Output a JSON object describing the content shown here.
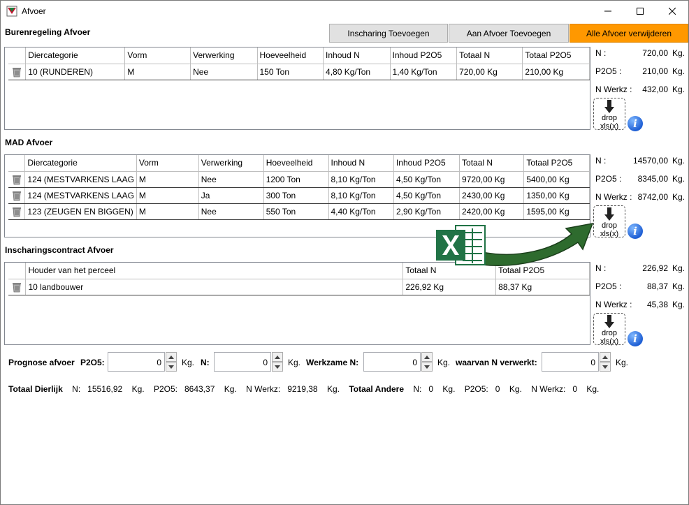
{
  "window": {
    "title": "Afvoer"
  },
  "buttons": {
    "inscharing": "Inscharing Toevoegen",
    "aan_afvoer": "Aan Afvoer Toevoegen",
    "alle_verwijderen": "Alle Afvoer verwijderen"
  },
  "burenregeling": {
    "title": "Burenregeling Afvoer",
    "columns": [
      "Diercategorie",
      "Vorm",
      "Verwerking",
      "Hoeveelheid",
      "Inhoud N",
      "Inhoud P2O5",
      "Totaal N",
      "Totaal P2O5"
    ],
    "rows": [
      [
        "10 (RUNDEREN)",
        "M",
        "Nee",
        "150 Ton",
        "4,80 Kg/Ton",
        "1,40 Kg/Ton",
        "720,00 Kg",
        "210,00 Kg"
      ]
    ],
    "summary": {
      "n_label": "N :",
      "n": "720,00",
      "p_label": "P2O5 :",
      "p": "210,00",
      "w_label": "N Werkz :",
      "w": "432,00",
      "unit": "Kg."
    }
  },
  "mad": {
    "title": "MAD Afvoer",
    "columns": [
      "Diercategorie",
      "Vorm",
      "Verwerking",
      "Hoeveelheid",
      "Inhoud N",
      "Inhoud P2O5",
      "Totaal N",
      "Totaal P2O5"
    ],
    "rows": [
      [
        "124 (MESTVARKENS LAAG",
        "M",
        "Nee",
        "1200 Ton",
        "8,10 Kg/Ton",
        "4,50 Kg/Ton",
        "9720,00 Kg",
        "5400,00 Kg"
      ],
      [
        "124 (MESTVARKENS LAAG",
        "M",
        "Ja",
        "300 Ton",
        "8,10 Kg/Ton",
        "4,50 Kg/Ton",
        "2430,00 Kg",
        "1350,00 Kg"
      ],
      [
        "123 (ZEUGEN EN BIGGEN)",
        "M",
        "Nee",
        "550 Ton",
        "4,40 Kg/Ton",
        "2,90 Kg/Ton",
        "2420,00 Kg",
        "1595,00 Kg"
      ]
    ],
    "summary": {
      "n_label": "N :",
      "n": "14570,00",
      "p_label": "P2O5 :",
      "p": "8345,00",
      "w_label": "N Werkz :",
      "w": "8742,00",
      "unit": "Kg."
    }
  },
  "inscharing": {
    "title": "Inscharingscontract Afvoer",
    "columns": [
      "Houder van het perceel",
      "Totaal N",
      "Totaal P2O5"
    ],
    "rows": [
      [
        "10 landbouwer",
        "226,92 Kg",
        "88,37 Kg"
      ]
    ],
    "summary": {
      "n_label": "N :",
      "n": "226,92",
      "p_label": "P2O5 :",
      "p": "88,37",
      "w_label": "N Werkz :",
      "w": "45,38",
      "unit": "Kg."
    }
  },
  "drop": {
    "line1": "drop",
    "line2": "xls(x)"
  },
  "info": {
    "glyph": "i"
  },
  "prognose": {
    "label": "Prognose afvoer",
    "p2o5_label": "P2O5:",
    "p2o5_value": "0",
    "n_label": "N:",
    "n_value": "0",
    "werkzame_label": "Werkzame N:",
    "werkzame_value": "0",
    "verwerkt_label": "waarvan N verwerkt:",
    "verwerkt_value": "0",
    "unit": "Kg."
  },
  "totals": {
    "dierlijk_label": "Totaal Dierlijk",
    "d_n_label": "N:",
    "d_n": "15516,92",
    "d_p_label": "P2O5:",
    "d_p": "8643,37",
    "d_w_label": "N Werkz:",
    "d_w": "9219,38",
    "andere_label": "Totaal Andere",
    "a_n_label": "N:",
    "a_n": "0",
    "a_p_label": "P2O5:",
    "a_p": "0",
    "a_w_label": "N Werkz:",
    "a_w": "0",
    "unit": "Kg."
  },
  "colors": {
    "accent_orange": "#ff9800",
    "excel_green": "#217346",
    "arrow_green": "#2e6b2e"
  }
}
